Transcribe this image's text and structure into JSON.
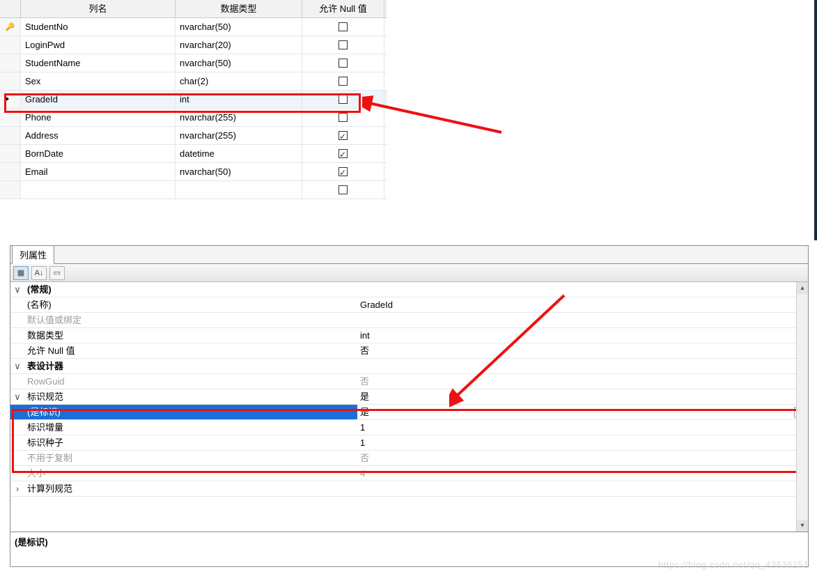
{
  "grid": {
    "headers": {
      "name": "列名",
      "type": "数据类型",
      "allownull": "允许 Null 值"
    },
    "rows": [
      {
        "key": true,
        "selected": false,
        "name": "StudentNo",
        "type": "nvarchar(50)",
        "null": false
      },
      {
        "key": false,
        "selected": false,
        "name": "LoginPwd",
        "type": "nvarchar(20)",
        "null": false
      },
      {
        "key": false,
        "selected": false,
        "name": "StudentName",
        "type": "nvarchar(50)",
        "null": false
      },
      {
        "key": false,
        "selected": false,
        "name": "Sex",
        "type": "char(2)",
        "null": false
      },
      {
        "key": false,
        "selected": true,
        "name": "GradeId",
        "type": "int",
        "null": false
      },
      {
        "key": false,
        "selected": false,
        "name": "Phone",
        "type": "nvarchar(255)",
        "null": false
      },
      {
        "key": false,
        "selected": false,
        "name": "Address",
        "type": "nvarchar(255)",
        "null": true
      },
      {
        "key": false,
        "selected": false,
        "name": "BornDate",
        "type": "datetime",
        "null": true
      },
      {
        "key": false,
        "selected": false,
        "name": "Email",
        "type": "nvarchar(50)",
        "null": true
      },
      {
        "key": false,
        "selected": false,
        "name": "",
        "type": "",
        "null": false,
        "empty": true
      }
    ]
  },
  "props": {
    "tab_label": "列属性",
    "groups": {
      "general_label": "(常规)",
      "name_label": "(名称)",
      "name_val": "GradeId",
      "default_label": "默认值或绑定",
      "default_val": "",
      "datatype_label": "数据类型",
      "datatype_val": "int",
      "allownull_label": "允许 Null 值",
      "allownull_val": "否",
      "tabledesigner_label": "表设计器",
      "rowguid_label": "RowGuid",
      "rowguid_val": "否",
      "identity_label": "标识规范",
      "identity_val": "是",
      "isidentity_label": "(是标识)",
      "isidentity_val": "是",
      "increment_label": "标识增量",
      "increment_val": "1",
      "seed_label": "标识种子",
      "seed_val": "1",
      "notforrepl_label": "不用于复制",
      "notforrepl_val": "否",
      "size_label": "大小",
      "size_val": "4",
      "computed_label": "计算列规范",
      "computed_val": ""
    },
    "footer": "(是标识)"
  },
  "watermark": "https://blog.csdn.net/qq_43636251"
}
